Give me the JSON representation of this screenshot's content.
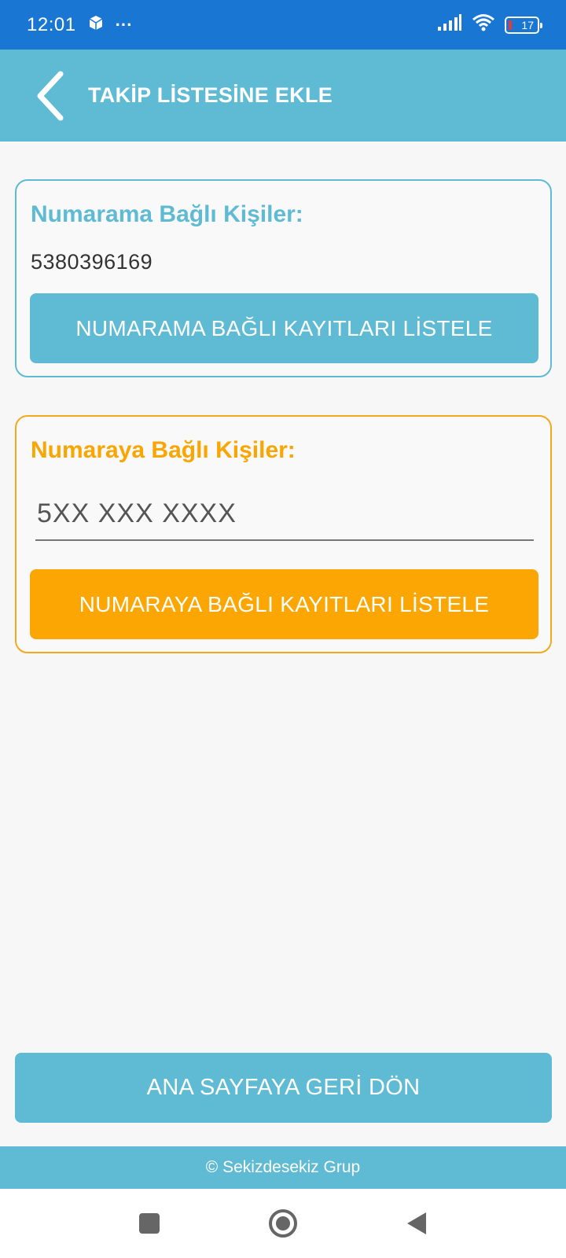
{
  "status_bar": {
    "time": "12:01",
    "more": "···",
    "battery": "17",
    "icons": [
      "box-icon",
      "signal-icon",
      "wifi-icon",
      "battery-icon"
    ]
  },
  "app_bar": {
    "title": "TAKİP LİSTESİNE EKLE",
    "back_icon": "chevron-left-icon"
  },
  "my_number_card": {
    "title": "Numarama Bağlı Kişiler:",
    "phone": "5380396169",
    "button_label": "NUMARAMA BAĞLI KAYITLARI LİSTELE",
    "accent": "#5fbad3"
  },
  "other_number_card": {
    "title": "Numaraya Bağlı Kişiler:",
    "input_placeholder": "5XX XXX XXXX",
    "input_value": "",
    "button_label": "NUMARAYA BAĞLI KAYITLARI LİSTELE",
    "accent": "#fba602"
  },
  "home_button": {
    "label": "ANA SAYFAYA GERİ DÖN"
  },
  "footer": {
    "text": "© Sekizdesekiz Grup"
  },
  "nav_bar": {
    "icons": [
      "recents-square-icon",
      "home-circle-icon",
      "back-triangle-icon"
    ]
  }
}
